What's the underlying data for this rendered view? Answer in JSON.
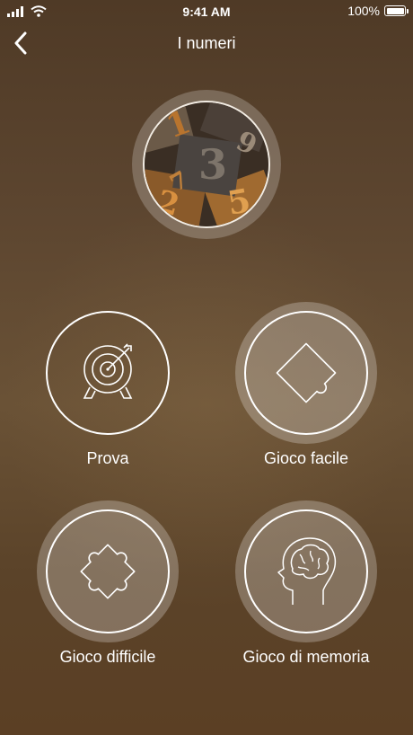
{
  "status_bar": {
    "time": "9:41 AM",
    "battery": "100%"
  },
  "nav": {
    "title": "I numeri",
    "back_icon": "chevron-left-icon"
  },
  "hero": {
    "image": "letterpress-numbers-image"
  },
  "tiles": [
    {
      "label": "Prova",
      "icon": "target-icon",
      "active": false
    },
    {
      "label": "Gioco facile",
      "icon": "puzzle-easy-icon",
      "active": true
    },
    {
      "label": "Gioco difficile",
      "icon": "puzzle-hard-icon",
      "active": true
    },
    {
      "label": "Gioco di memoria",
      "icon": "brain-head-icon",
      "active": true
    }
  ]
}
